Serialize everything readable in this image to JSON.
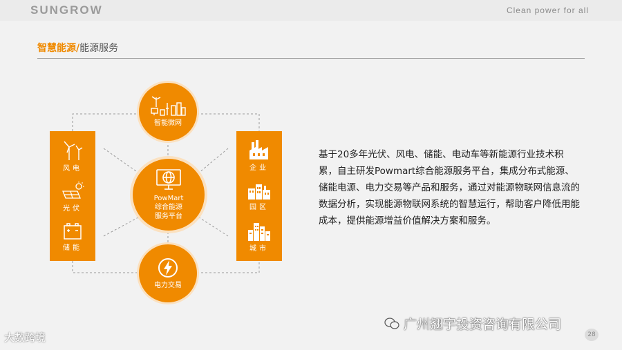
{
  "header": {
    "brand": "SUNGROW",
    "tagline": "Clean power for all"
  },
  "section": {
    "title_accent": "智慧能源/",
    "title_rest": "能源服务"
  },
  "diagram": {
    "top": {
      "label": "智能微网"
    },
    "center": {
      "line1": "PowMart",
      "line2": "综合能源",
      "line3": "服务平台"
    },
    "bottom": {
      "label": "电力交易"
    },
    "left": [
      {
        "label": "风电"
      },
      {
        "label": "光伏"
      },
      {
        "label": "储能"
      }
    ],
    "right": [
      {
        "label": "企业"
      },
      {
        "label": "园区"
      },
      {
        "label": "城市"
      }
    ],
    "colors": {
      "accent": "#f08a00",
      "ring": "#fbe1c0"
    }
  },
  "description": "基于20多年光伏、风电、储能、电动车等新能源行业技术积累，自主研发Powmart综合能源服务平台，集成分布式能源、储能电源、电力交易等产品和服务，通过对能源物联网信息流的数据分析，实现能源物联网系统的智慧运行，帮助客户降低用能成本，提供能源增益价值解决方案和服务。",
  "watermark_right": "广州翘宇投资咨询有限公司",
  "watermark_left": "大数跨境",
  "page_number": "28"
}
